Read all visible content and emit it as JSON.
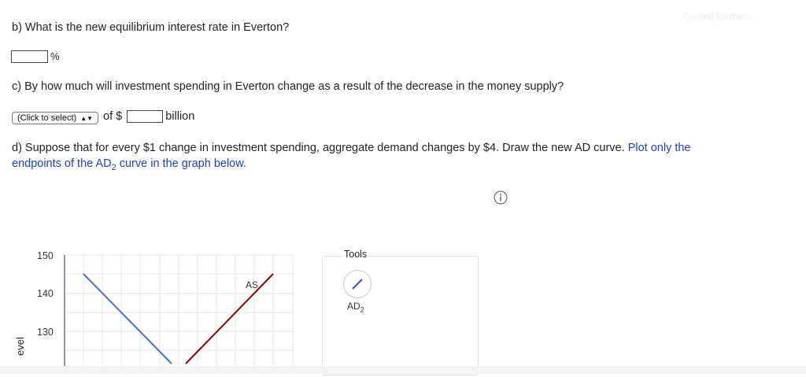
{
  "watermark": "Cornell Brothers",
  "question_b": {
    "text": "b) What is the new equilibrium interest rate in Everton?",
    "input_value": "",
    "unit": "%"
  },
  "question_c": {
    "text": "c) By how much will investment spending in Everton change as a result of the decrease in the money supply?",
    "select_value": "(Click to select)",
    "of_text": "of $",
    "input_value": "",
    "unit": "billion"
  },
  "question_d": {
    "text_main": "d) Suppose that for every $1 change in investment spending, aggregate demand changes by $4. Draw the new AD curve.",
    "text_instruction_1": "Plot only the",
    "text_instruction_2": "endpoints of the AD",
    "subscript": "2",
    "text_instruction_3": "curve in the graph below."
  },
  "info_icon": "info-icon",
  "graph": {
    "y_axis_label": "evel",
    "y_ticks": [
      "150",
      "140",
      "130"
    ],
    "curve_label_as": "AS",
    "colors": {
      "ad_line": "#4a6fd4",
      "as_line": "#8b0000",
      "grid": "#e6e6e6"
    }
  },
  "tools": {
    "title": "Tools",
    "tool_label": "AD",
    "tool_subscript": "2",
    "tool_icon": "line-draw-icon"
  }
}
